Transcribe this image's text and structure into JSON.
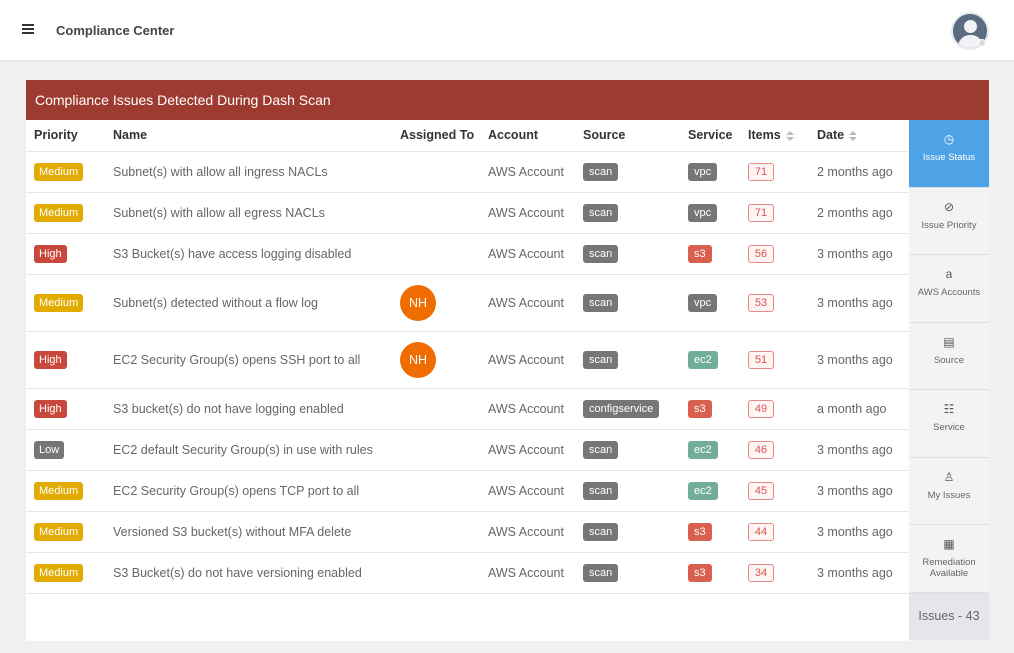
{
  "app": {
    "title": "Compliance Center"
  },
  "card": {
    "title": "Compliance Issues Detected During Dash Scan"
  },
  "table": {
    "headers": {
      "priority": "Priority",
      "name": "Name",
      "assigned": "Assigned To",
      "account": "Account",
      "source": "Source",
      "service": "Service",
      "items": "Items",
      "date": "Date"
    },
    "rows": [
      {
        "priority": "Medium",
        "name": "Subnet(s) with allow all ingress NACLs",
        "assigned": "",
        "account": "AWS Account",
        "source": "scan",
        "service": "vpc",
        "items": "71",
        "date": "2 months ago"
      },
      {
        "priority": "Medium",
        "name": "Subnet(s) with allow all egress NACLs",
        "assigned": "",
        "account": "AWS Account",
        "source": "scan",
        "service": "vpc",
        "items": "71",
        "date": "2 months ago"
      },
      {
        "priority": "High",
        "name": "S3 Bucket(s) have access logging disabled",
        "assigned": "",
        "account": "AWS Account",
        "source": "scan",
        "service": "s3",
        "items": "56",
        "date": "3 months ago"
      },
      {
        "priority": "Medium",
        "name": "Subnet(s) detected without a flow log",
        "assigned": "NH",
        "account": "AWS Account",
        "source": "scan",
        "service": "vpc",
        "items": "53",
        "date": "3 months ago"
      },
      {
        "priority": "High",
        "name": "EC2 Security Group(s) opens SSH port to all",
        "assigned": "NH",
        "account": "AWS Account",
        "source": "scan",
        "service": "ec2",
        "items": "51",
        "date": "3 months ago"
      },
      {
        "priority": "High",
        "name": "S3 bucket(s) do not have logging enabled",
        "assigned": "",
        "account": "AWS Account",
        "source": "configservice",
        "service": "s3",
        "items": "49",
        "date": "a month ago"
      },
      {
        "priority": "Low",
        "name": "EC2 default Security Group(s) in use with rules",
        "assigned": "",
        "account": "AWS Account",
        "source": "scan",
        "service": "ec2",
        "items": "46",
        "date": "3 months ago"
      },
      {
        "priority": "Medium",
        "name": "EC2 Security Group(s) opens TCP port to all",
        "assigned": "",
        "account": "AWS Account",
        "source": "scan",
        "service": "ec2",
        "items": "45",
        "date": "3 months ago"
      },
      {
        "priority": "Medium",
        "name": "Versioned S3 bucket(s) without MFA delete",
        "assigned": "",
        "account": "AWS Account",
        "source": "scan",
        "service": "s3",
        "items": "44",
        "date": "3 months ago"
      },
      {
        "priority": "Medium",
        "name": "S3 Bucket(s) do not have versioning enabled",
        "assigned": "",
        "account": "AWS Account",
        "source": "scan",
        "service": "s3",
        "items": "34",
        "date": "3 months ago"
      }
    ]
  },
  "sidebar": {
    "items": [
      {
        "label": "Issue Status",
        "icon": "clock-icon"
      },
      {
        "label": "Issue Priority",
        "icon": "compass-icon"
      },
      {
        "label": "AWS Accounts",
        "icon": "amazon-icon"
      },
      {
        "label": "Source",
        "icon": "list-icon"
      },
      {
        "label": "Service",
        "icon": "sitemap-icon"
      },
      {
        "label": "My Issues",
        "icon": "user-icon"
      },
      {
        "label": "Remediation Available",
        "icon": "tool-icon"
      }
    ],
    "footer": "Issues - 43"
  },
  "colors": {
    "header": "#9e3b31",
    "medium": "#e2ab00",
    "high": "#c9483c",
    "low": "#767676",
    "scan": "#767676",
    "vpc": "#767676",
    "s3": "#d9604f",
    "ec2": "#72ad9b",
    "assignee": "#ef6c00",
    "active": "#4ea2e6"
  }
}
